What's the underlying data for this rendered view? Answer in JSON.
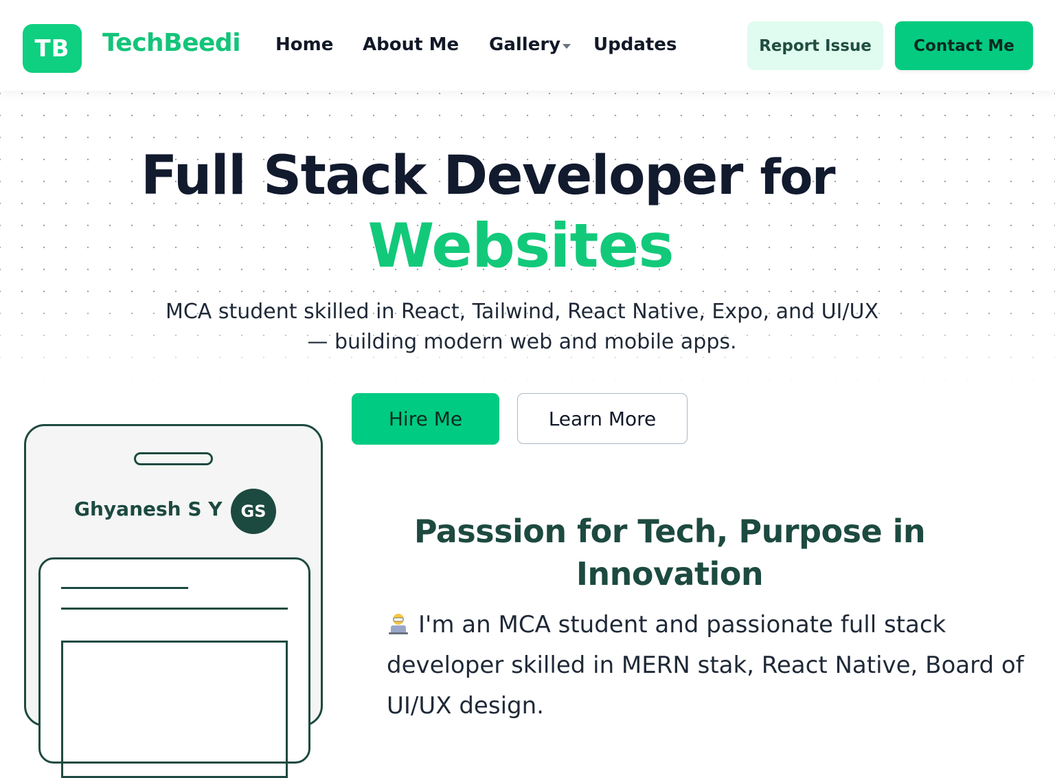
{
  "nav": {
    "logo_text": "TB",
    "brand": "TechBeedi",
    "links": [
      {
        "label": "Home"
      },
      {
        "label": "About Me"
      },
      {
        "label": "Gallery"
      },
      {
        "label": "Updates"
      }
    ],
    "report_label": "Report Issue",
    "contact_label": "Contact Me"
  },
  "hero": {
    "title_main": "Full Stack Developer",
    "title_for": "for",
    "title_highlight": "Websites",
    "description": "MCA student skilled in React, Tailwind, React Native, Expo, and UI/UX — building modern web and mobile apps.",
    "hire_label": "Hire Me",
    "learn_label": "Learn More"
  },
  "phone": {
    "name": "Ghyanesh S Y",
    "avatar_initials": "GS"
  },
  "passion": {
    "title": "Passsion for Tech, Purpose in Innovation",
    "body": "I'm an MCA student and passionate full stack developer skilled in MERN stak, React Native, Board of UI/UX design."
  },
  "colors": {
    "accent": "#05cb80",
    "brand_text": "#14c47a",
    "dark_green": "#1d4a40",
    "heading": "#121a2e"
  }
}
